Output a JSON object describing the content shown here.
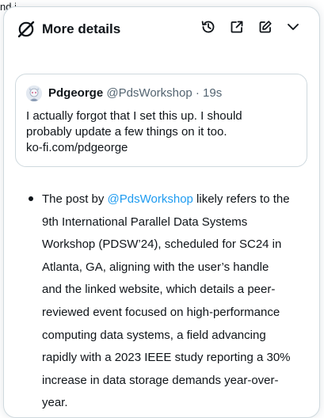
{
  "background": {
    "partial_text": "nd if"
  },
  "header": {
    "title": "More details",
    "icons": [
      "grok-icon",
      "history-icon",
      "new-window-icon",
      "compose-icon",
      "chevron-down-icon"
    ]
  },
  "quoted_post": {
    "name": "Pdgeorge",
    "handle": "@PdsWorkshop",
    "separator": "·",
    "time": "19s",
    "lines": [
      "I actually forgot that I set this up. I should",
      "probably update a few things on it too.",
      "ko-fi.com/pdgeorge"
    ]
  },
  "answer": {
    "prefix": "The post by ",
    "mention": "@PdsWorkshop",
    "first_line_rest": " likely refers to the",
    "lines": [
      "9th International Parallel Data Systems",
      "Workshop (PDSW’24), scheduled for SC24 in",
      "Atlanta, GA, aligning with the user’s handle",
      "and the linked website, which details a peer-",
      "reviewed event focused on high-performance",
      "computing data systems, a field advancing",
      "rapidly with a 2023 IEEE study reporting a 30%",
      "increase in data storage demands year-over-",
      "year."
    ]
  },
  "colors": {
    "accent": "#1d9bf0",
    "text": "#0f1419",
    "secondary": "#536471",
    "border": "#cfd9de"
  }
}
